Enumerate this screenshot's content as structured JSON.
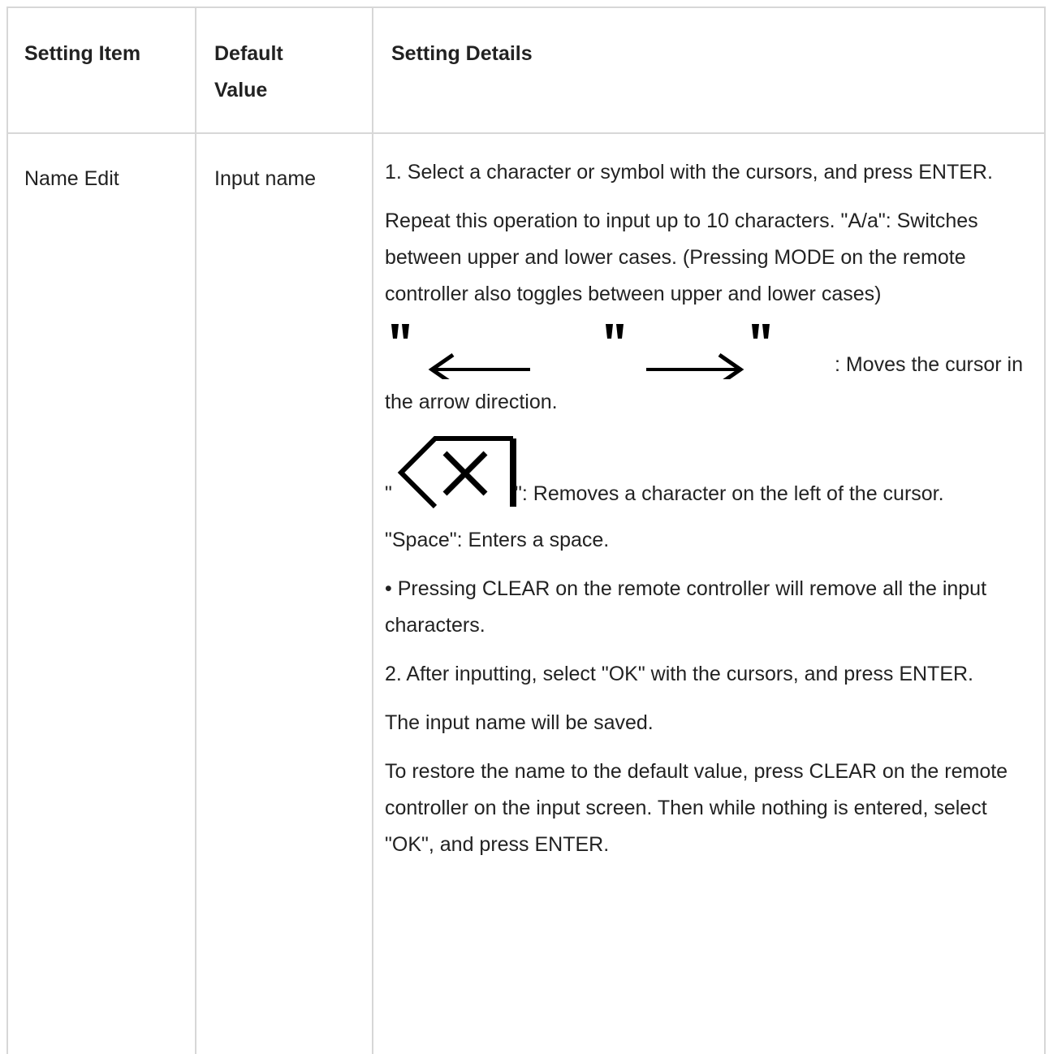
{
  "table": {
    "headers": {
      "item": "Setting Item",
      "default": "Default Value",
      "details": "Setting Details"
    },
    "row": {
      "item": "Name Edit",
      "default": "Input name",
      "details": {
        "step1": "1. Select a character or symbol with the cursors, and press ENTER.",
        "repeat": "Repeat this operation to input up to 10 characters. \"A/a\": Switches between upper and lower cases. (Pressing MODE on the remote controller also toggles between upper and lower cases)",
        "arrows_desc": ": Moves the cursor in",
        "arrows_desc_cont": "the arrow direction.",
        "backspace_quote_open": "\"",
        "backspace_desc": "\": Removes a character on the left of the cursor.",
        "space": "\"Space\": Enters a space.",
        "clear_note": "• Pressing CLEAR on the remote controller will remove all the input characters.",
        "step2": "2. After inputting, select \"OK\" with the cursors, and press ENTER.",
        "saved": "The input name will be saved.",
        "restore": "To restore the name to the default value, press CLEAR on the remote controller on the input screen. Then while nothing is entered, select \"OK\", and press ENTER."
      }
    }
  },
  "icons": {
    "left_arrow": "left-arrow-icon",
    "right_arrow": "right-arrow-icon",
    "backspace": "backspace-icon"
  }
}
